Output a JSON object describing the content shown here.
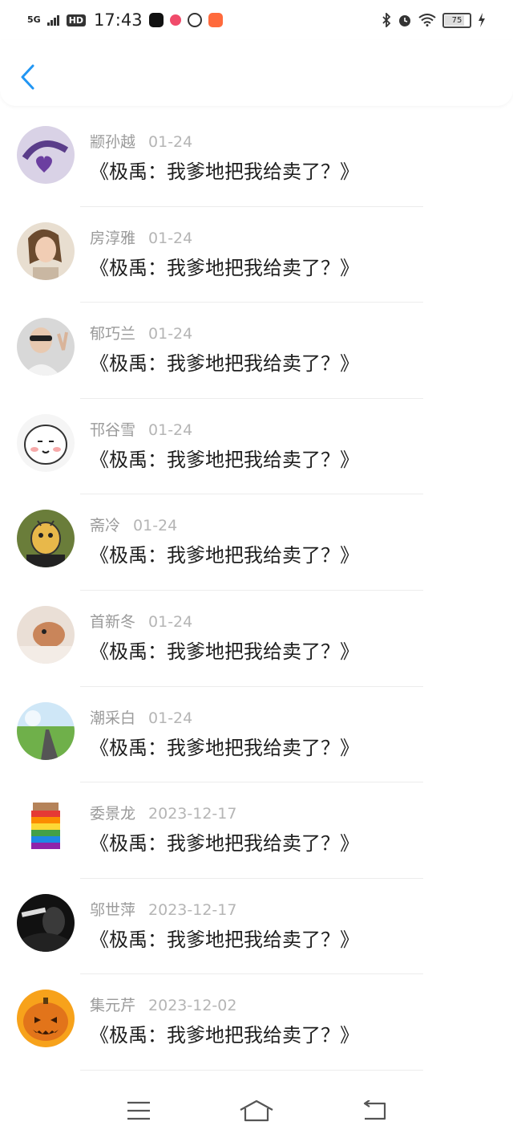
{
  "status_bar": {
    "network": "5G",
    "hd": "HD",
    "time": "17:43",
    "battery": "75"
  },
  "header": {
    "back_icon": "chevron-left-icon"
  },
  "accent_color": "#2196f3",
  "items": [
    {
      "name": "颛孙越",
      "date": "01-24",
      "title": "《极禹：我爹地把我给卖了？》"
    },
    {
      "name": "房淳雅",
      "date": "01-24",
      "title": "《极禹：我爹地把我给卖了？》"
    },
    {
      "name": "郁巧兰",
      "date": "01-24",
      "title": "《极禹：我爹地把我给卖了？》"
    },
    {
      "name": "邗谷雪",
      "date": "01-24",
      "title": "《极禹：我爹地把我给卖了？》"
    },
    {
      "name": "斋冷",
      "date": "01-24",
      "title": "《极禹：我爹地把我给卖了？》"
    },
    {
      "name": "首新冬",
      "date": "01-24",
      "title": "《极禹：我爹地把我给卖了？》"
    },
    {
      "name": "潮采白",
      "date": "01-24",
      "title": "《极禹：我爹地把我给卖了？》"
    },
    {
      "name": "委景龙",
      "date": "2023-12-17",
      "title": "《极禹：我爹地把我给卖了？》"
    },
    {
      "name": "邬世萍",
      "date": "2023-12-17",
      "title": "《极禹：我爹地把我给卖了？》"
    },
    {
      "name": "集元芹",
      "date": "2023-12-02",
      "title": "《极禹：我爹地把我给卖了？》"
    }
  ],
  "nav": {
    "menu_icon": "menu-icon",
    "home_icon": "home-icon",
    "back_icon": "back-icon"
  }
}
